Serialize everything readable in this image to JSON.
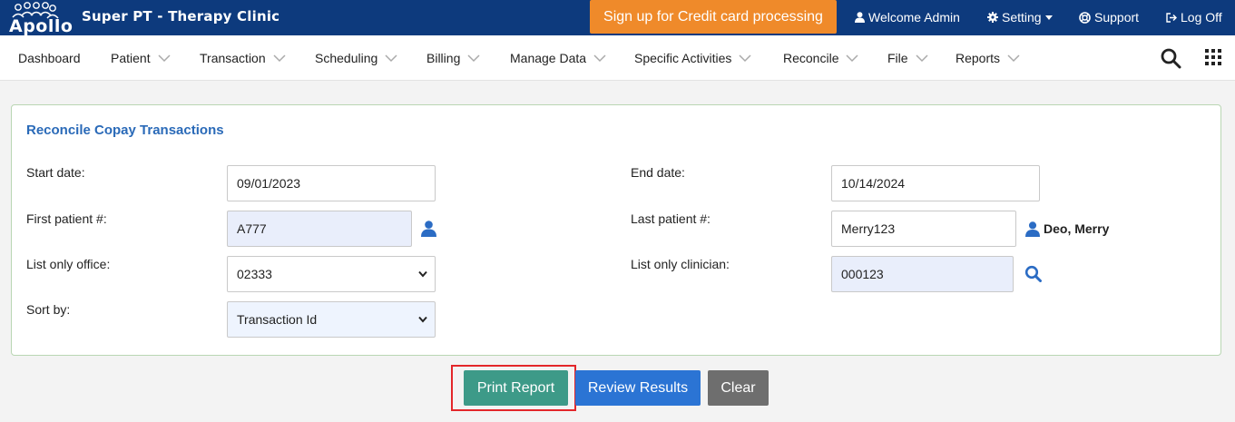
{
  "app": {
    "logo_text": "Apollo",
    "clinic_name": "Super PT - Therapy Clinic",
    "signup_label": "Sign up for Credit card processing",
    "welcome_label": "Welcome Admin",
    "setting_label": "Setting",
    "support_label": "Support",
    "logoff_label": "Log Off"
  },
  "nav": {
    "items": [
      {
        "label": "Dashboard"
      },
      {
        "label": "Patient"
      },
      {
        "label": "Transaction"
      },
      {
        "label": "Scheduling"
      },
      {
        "label": "Billing"
      },
      {
        "label": "Manage Data"
      },
      {
        "label": "Specific Activities"
      },
      {
        "label": "Reconcile"
      },
      {
        "label": "File"
      },
      {
        "label": "Reports"
      }
    ]
  },
  "form": {
    "title": "Reconcile Copay Transactions",
    "start_date_label": "Start date:",
    "start_date_value": "09/01/2023",
    "end_date_label": "End date:",
    "end_date_value": "10/14/2024",
    "first_patient_label": "First patient #:",
    "first_patient_value": "A777",
    "last_patient_label": "Last patient #:",
    "last_patient_value": "Merry123",
    "last_patient_name": "Deo, Merry",
    "office_label": "List only office:",
    "office_value": "02333",
    "clinician_label": "List only clinician:",
    "clinician_value": "000123",
    "sort_label": "Sort by:",
    "sort_value": "Transaction Id"
  },
  "actions": {
    "print_label": "Print Report",
    "review_label": "Review Results",
    "clear_label": "Clear"
  },
  "colors": {
    "topbar": "#0d3a7d",
    "signup": "#ef8a2a",
    "title": "#2a6ab8",
    "print": "#3d9a88",
    "review": "#2b74d4",
    "clear": "#6e6e6e",
    "highlight": "#e3262a"
  }
}
